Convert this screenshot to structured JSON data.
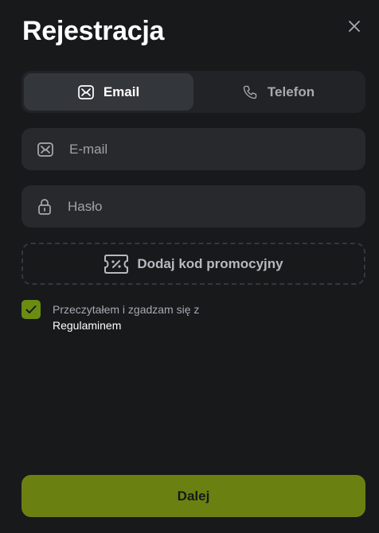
{
  "title": "Rejestracja",
  "tabs": [
    {
      "label": "Email",
      "icon": "email-icon",
      "active": true
    },
    {
      "label": "Telefon",
      "icon": "phone-icon",
      "active": false
    }
  ],
  "email_field": {
    "placeholder": "E-mail",
    "value": "",
    "icon": "email-icon"
  },
  "password_field": {
    "placeholder": "Hasło",
    "value": "",
    "icon": "lock-icon"
  },
  "promo": {
    "label": "Dodaj kod promocyjny",
    "icon": "coupon-icon"
  },
  "terms": {
    "checked": true,
    "text": "Przeczytałem i zgadzam się z",
    "link": "Regulaminem"
  },
  "submit": {
    "label": "Dalej"
  },
  "colors": {
    "background": "#17191b",
    "accent": "#6a8112",
    "field": "#27292d"
  }
}
